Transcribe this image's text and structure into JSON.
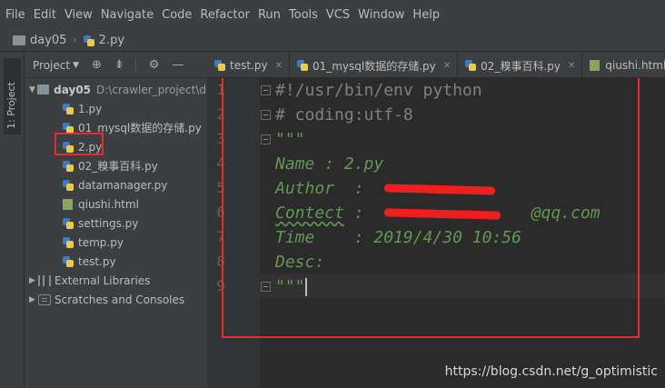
{
  "menu": [
    "File",
    "Edit",
    "View",
    "Navigate",
    "Code",
    "Refactor",
    "Run",
    "Tools",
    "VCS",
    "Window",
    "Help"
  ],
  "breadcrumb": {
    "folder": "day05",
    "file": "2.py"
  },
  "toolwindow": {
    "tab_label": "1: Project"
  },
  "project_panel": {
    "title": "Project",
    "root": {
      "name": "day05",
      "path": "D:\\crawler_project\\d"
    },
    "files": [
      {
        "name": "1.py",
        "type": "py"
      },
      {
        "name": "01_mysql数据的存储.py",
        "type": "py"
      },
      {
        "name": "2.py",
        "type": "py"
      },
      {
        "name": "02_糗事百科.py",
        "type": "py"
      },
      {
        "name": "datamanager.py",
        "type": "py"
      },
      {
        "name": "qiushi.html",
        "type": "html"
      },
      {
        "name": "settings.py",
        "type": "py"
      },
      {
        "name": "temp.py",
        "type": "py"
      },
      {
        "name": "test.py",
        "type": "py"
      }
    ],
    "external_libraries": "External Libraries",
    "scratches": "Scratches and Consoles"
  },
  "tabs": [
    {
      "label": "test.py",
      "type": "py"
    },
    {
      "label": "01_mysql数据的存储.py",
      "type": "py"
    },
    {
      "label": "02_糗事百科.py",
      "type": "py"
    },
    {
      "label": "qiushi.html",
      "type": "html"
    }
  ],
  "editor": {
    "line_numbers": [
      "1",
      "2",
      "3",
      "4",
      "5",
      "6",
      "7",
      "8",
      "9"
    ],
    "lines": [
      "#!/usr/bin/env python",
      "# coding:utf-8",
      "\"\"\"",
      "Name : 2.py",
      "Author  : ",
      "Contect : ",
      "Time    : 2019/4/30 10:56",
      "Desc:",
      "\"\"\""
    ],
    "contect_suffix": "@qq.com",
    "contect_word": "Contect"
  },
  "watermark": "https://blog.csdn.net/g_optimistic",
  "colors": {
    "background": "#2b2b2b",
    "comment_gray": "#808080",
    "docstring_green": "#629755",
    "highlight_red": "#e82c2c"
  }
}
